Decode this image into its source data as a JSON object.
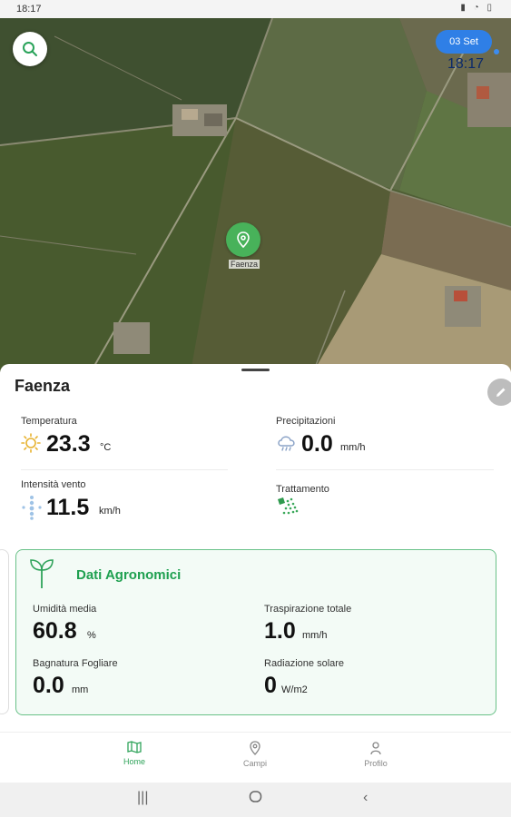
{
  "status_bar": {
    "time": "18:17"
  },
  "map": {
    "date_button": "03 Set",
    "time": "18:17",
    "pin_label": "Faenza"
  },
  "location": {
    "name": "Faenza"
  },
  "weather": {
    "temperature": {
      "label": "Temperatura",
      "value": "23.3",
      "unit": "°C"
    },
    "precipitation": {
      "label": "Precipitazioni",
      "value": "0.0",
      "unit": "mm/h"
    },
    "wind": {
      "label": "Intensità vento",
      "value": "11.5",
      "unit": "km/h"
    },
    "treatment": {
      "label": "Trattamento"
    }
  },
  "agronomic": {
    "title": "Dati Agronomici",
    "humidity": {
      "label": "Umidità media",
      "value": "60.8",
      "unit": "%"
    },
    "transpiration": {
      "label": "Traspirazione totale",
      "value": "1.0",
      "unit": "mm/h"
    },
    "leaf_wetness": {
      "label": "Bagnatura Fogliare",
      "value": "0.0",
      "unit": "mm"
    },
    "solar_radiation": {
      "label": "Radiazione solare",
      "value": "0",
      "unit": "W/m2"
    }
  },
  "bottom_nav": {
    "items": [
      {
        "label": "Home",
        "icon": "map-icon",
        "active": true
      },
      {
        "label": "Campi",
        "icon": "location-pin-icon",
        "active": false
      },
      {
        "label": "Profilo",
        "icon": "person-icon",
        "active": false
      }
    ]
  },
  "colors": {
    "accent_green": "#1fa050",
    "date_blue": "#2f7fe6",
    "card_border": "#69c188"
  }
}
